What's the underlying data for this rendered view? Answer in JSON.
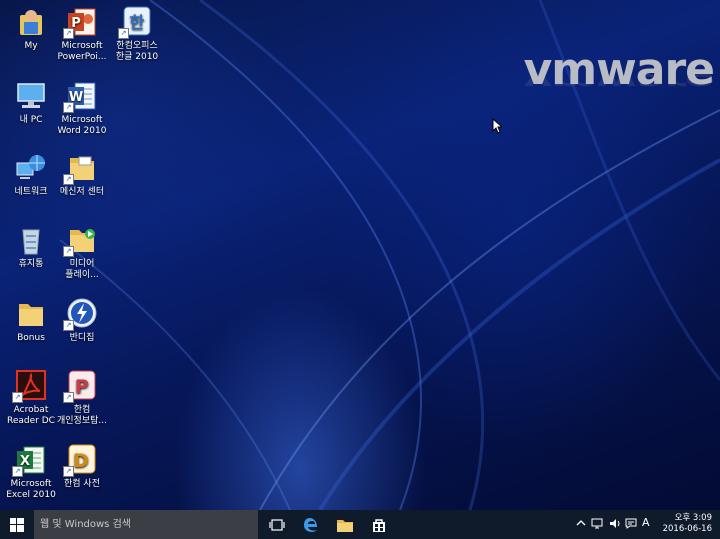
{
  "desktop": {
    "brand_text": "vmware",
    "icons": [
      {
        "name": "user-folder-icon",
        "label": "My"
      },
      {
        "name": "powerpoint-icon",
        "label": "Microsoft\nPowerPoi..."
      },
      {
        "name": "hancom-office-icon",
        "label": "한컴오피스\n한글 2010"
      },
      {
        "name": "this-pc-icon",
        "label": "내 PC"
      },
      {
        "name": "word-icon",
        "label": "Microsoft\nWord 2010"
      },
      {
        "name": "network-icon",
        "label": "네트워크"
      },
      {
        "name": "messenger-center-folder-icon",
        "label": "메신저 센터"
      },
      {
        "name": "recycle-bin-icon",
        "label": "휴지통"
      },
      {
        "name": "media-player-folder-icon",
        "label": "미디어\n플레이..."
      },
      {
        "name": "bonus-folder-icon",
        "label": "Bonus"
      },
      {
        "name": "bandizip-icon",
        "label": "반디집"
      },
      {
        "name": "acrobat-reader-icon",
        "label": "Acrobat\nReader DC"
      },
      {
        "name": "hancom-privacy-icon",
        "label": "한컴\n개인정보탐..."
      },
      {
        "name": "excel-icon",
        "label": "Microsoft\nExcel 2010"
      },
      {
        "name": "hancom-dictionary-icon",
        "label": "한컴 사전"
      }
    ]
  },
  "taskbar": {
    "search_placeholder": "웹 및 Windows 검색",
    "ime_indicator": "A",
    "clock": {
      "ampm_time": "오후 3:09",
      "date": "2016-06-16"
    }
  },
  "colors": {
    "taskbar_bg": "#0f1a2b",
    "search_bg": "#3b3f45",
    "desktop_blue": "#0a2378"
  }
}
